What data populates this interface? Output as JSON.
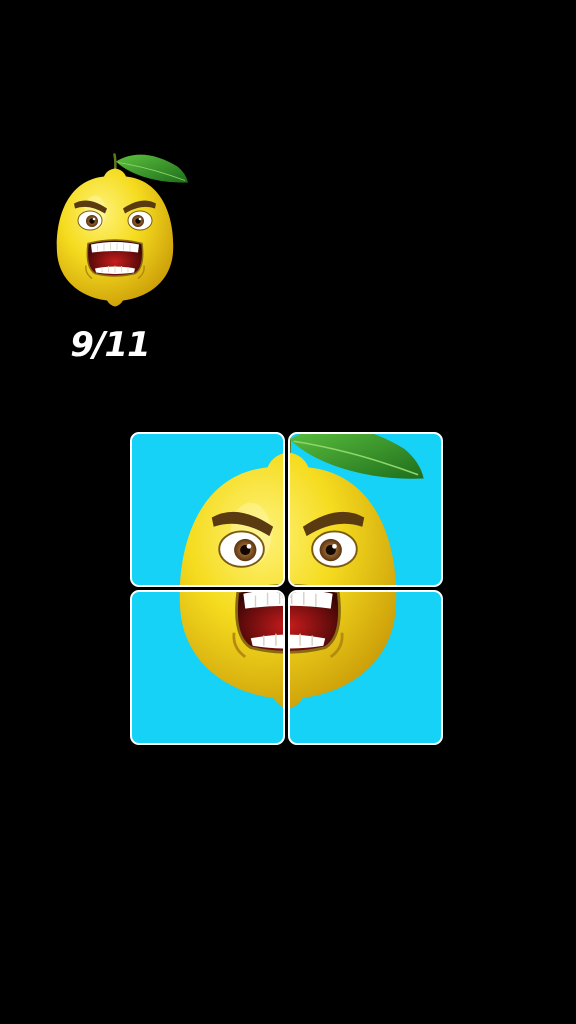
{
  "progress": {
    "label": "9/11",
    "current": 9,
    "total": 11
  },
  "colors": {
    "background": "#000000",
    "tile_background": "#16d2f6",
    "tile_border": "#ffffff",
    "lemon": "#f5dc1f",
    "leaf": "#2e8f2a",
    "text": "#ffffff"
  },
  "reference_image": {
    "icon": "angry-lemon-icon"
  },
  "board": {
    "icon": "angry-lemon-icon",
    "tiles": [
      {
        "name": "puzzle-tile-top-left"
      },
      {
        "name": "puzzle-tile-top-right"
      },
      {
        "name": "puzzle-tile-bottom-left"
      },
      {
        "name": "puzzle-tile-bottom-right"
      }
    ]
  }
}
